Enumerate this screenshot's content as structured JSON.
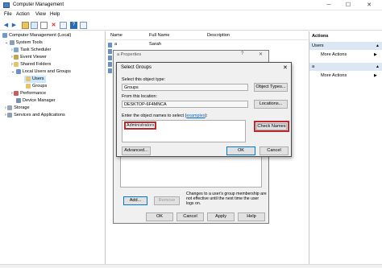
{
  "window": {
    "title": "Computer Management",
    "minimize": "─",
    "maximize": "☐",
    "close": "✕"
  },
  "menu": [
    "File",
    "Action",
    "View",
    "Help"
  ],
  "tree": {
    "root": "Computer Management (Local)",
    "system_tools": "System Tools",
    "task_scheduler": "Task Scheduler",
    "event_viewer": "Event Viewer",
    "shared_folders": "Shared Folders",
    "local_users_groups": "Local Users and Groups",
    "users": "Users",
    "groups": "Groups",
    "performance": "Performance",
    "device_manager": "Device Manager",
    "storage": "Storage",
    "services_apps": "Services and Applications"
  },
  "list": {
    "col_name": "Name",
    "col_fullname": "Full Name",
    "col_description": "Description",
    "row1_name": "a",
    "row1_fullname": "Sarah"
  },
  "actions": {
    "header": "Actions",
    "section1": "Users",
    "more_actions_1": "More Actions",
    "section2": "a",
    "more_actions_2": "More Actions"
  },
  "properties": {
    "title": "a Properties",
    "help": "?",
    "close": "✕",
    "add": "Add...",
    "remove": "Remove",
    "note": "Changes to a user's group membership are not effective until the next time the user logs on.",
    "ok": "OK",
    "cancel": "Cancel",
    "apply": "Apply",
    "help_btn": "Help"
  },
  "select_groups": {
    "title": "Select Groups",
    "close": "✕",
    "object_type_label": "Select this object type:",
    "object_type_value": "Groups",
    "object_types_button": "Object Types...",
    "location_label": "From this location:",
    "location_value": "DESKTOP-6F4MNCA",
    "locations_button": "Locations...",
    "names_label_prefix": "Enter the object names to select (",
    "names_label_link": "examples",
    "names_label_suffix": "):",
    "names_value": "Administrators",
    "check_names_button": "Check Names",
    "advanced_button": "Advanced...",
    "ok": "OK",
    "cancel": "Cancel"
  }
}
